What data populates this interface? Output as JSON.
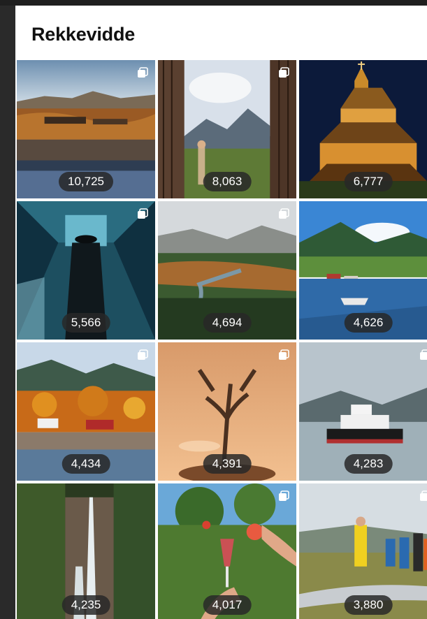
{
  "page": {
    "title": "Rekkevidde"
  },
  "tiles": [
    {
      "count": "10,725",
      "scene": "lake-valley"
    },
    {
      "count": "8,063",
      "scene": "doorway-mountain"
    },
    {
      "count": "6,777",
      "scene": "stave-church"
    },
    {
      "count": "5,566",
      "scene": "tunnel-guard"
    },
    {
      "count": "4,694",
      "scene": "forest-river"
    },
    {
      "count": "4,626",
      "scene": "fjord-boat"
    },
    {
      "count": "4,434",
      "scene": "autumn-lake"
    },
    {
      "count": "4,391",
      "scene": "antler-sculpture"
    },
    {
      "count": "4,283",
      "scene": "ferry"
    },
    {
      "count": "4,235",
      "scene": "waterfall"
    },
    {
      "count": "4,017",
      "scene": "apple-glass"
    },
    {
      "count": "3,880",
      "scene": "family-hike"
    }
  ],
  "icons": {
    "multi_post": "multiple-images-icon"
  }
}
